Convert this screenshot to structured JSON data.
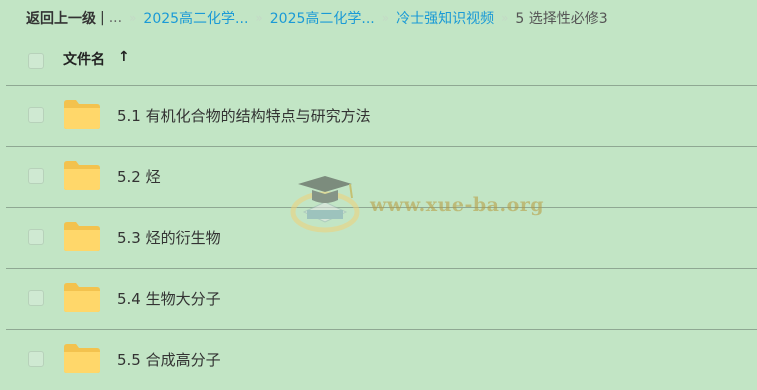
{
  "breadcrumb": {
    "back_label": "返回上一级",
    "separator": "|",
    "ellipsis": "...",
    "crumb_separator": "»",
    "items": [
      "2025高二化学...",
      "2025高二化学...",
      "冷士强知识视频"
    ],
    "current": "5 选择性必修3"
  },
  "table": {
    "column_name": "文件名",
    "sort_indicator": "↑",
    "rows": [
      {
        "label": "5.1 有机化合物的结构特点与研究方法",
        "icon": "folder-icon"
      },
      {
        "label": "5.2 烃",
        "icon": "folder-icon"
      },
      {
        "label": "5.3 烃的衍生物",
        "icon": "folder-icon"
      },
      {
        "label": "5.4 生物大分子",
        "icon": "folder-icon"
      },
      {
        "label": "5.5 合成高分子",
        "icon": "folder-icon"
      }
    ]
  },
  "watermark": {
    "text": "www.xue-ba.org"
  },
  "colors": {
    "background": "#c2e5c5",
    "link": "#1a9ad6",
    "folder": "#ffd76a",
    "watermark": "#b89a3c"
  }
}
